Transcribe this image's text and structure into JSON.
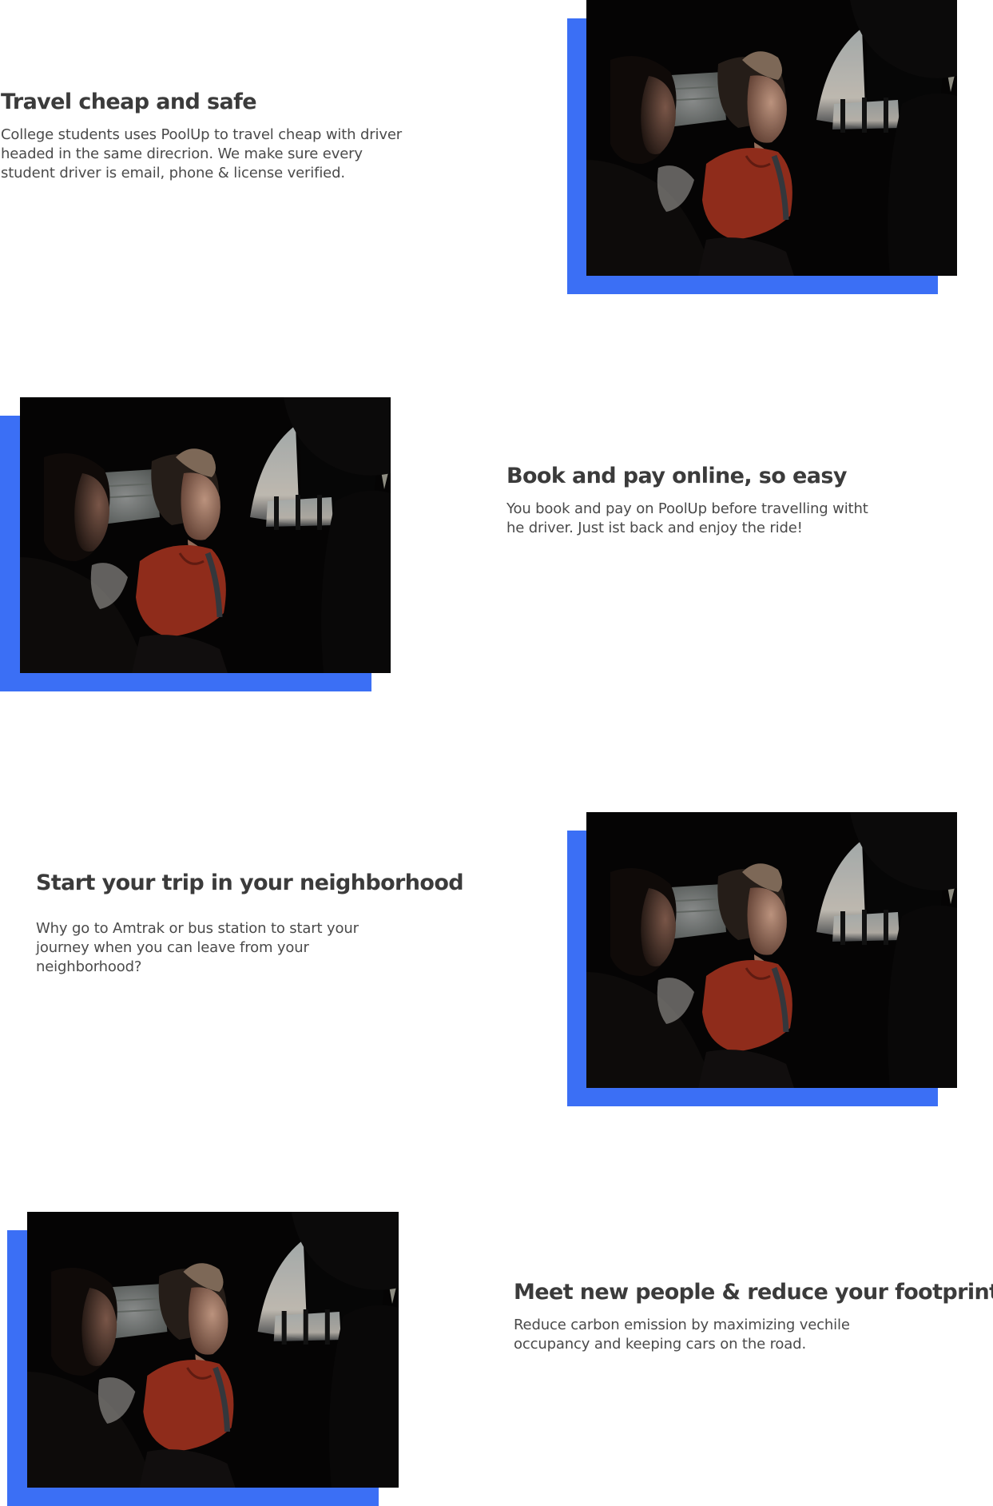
{
  "colors": {
    "accent": "#3b6ff5",
    "heading": "#3b3b3b",
    "body_text": "#4a4a4a",
    "background": "#ffffff"
  },
  "features": [
    {
      "title": "Travel cheap and safe",
      "description": "College students uses PoolUp to travel cheap with driver\nheaded in the same direcrion. We make sure every\nstudent driver is email, phone & license verified.",
      "image_alt": "Two women looking out of a car window"
    },
    {
      "title": "Book and pay online, so easy",
      "description": "You book and pay on PoolUp before travelling witht\nhe driver. Just ist back and enjoy the ride!",
      "image_alt": "Two women looking out of a car window"
    },
    {
      "title": "Start your trip in your neighborhood",
      "description": "Why go to Amtrak or bus station to start your\njourney when you can leave from your\nneighborhood?",
      "image_alt": "Two women looking out of a car window"
    },
    {
      "title": "Meet new people & reduce your footprint",
      "description": "Reduce carbon emission by maximizing vechile\noccupancy and keeping cars on the road.",
      "image_alt": "Two women looking out of a car window"
    }
  ]
}
